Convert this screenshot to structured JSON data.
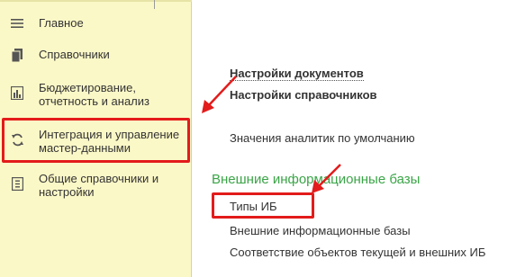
{
  "colors": {
    "sidebar_bg": "#fbf8c7",
    "section_title": "#3aa547",
    "annotation_red": "#e31b1b",
    "text": "#333333"
  },
  "sidebar": {
    "items": [
      {
        "label": "Главное",
        "icon": "menu-lines-icon"
      },
      {
        "label": "Справочники",
        "icon": "books-icon"
      },
      {
        "label": "Бюджетирование, отчетность и анализ",
        "icon": "bar-chart-icon"
      },
      {
        "label": "Интеграция и управление мастер-данными",
        "icon": "sync-arrows-icon"
      },
      {
        "label": "Общие справочники и настройки",
        "icon": "catalog-icon"
      }
    ]
  },
  "main": {
    "settings_documents": "Настройки документов",
    "settings_catalogs": "Настройки справочников",
    "default_analytics": "Значения аналитик по умолчанию",
    "external_section_title": "Внешние информационные базы",
    "links": {
      "ib_types": "Типы ИБ",
      "external_ib": "Внешние информационные базы",
      "object_mapping": "Соответствие объектов текущей и внешних ИБ"
    }
  }
}
